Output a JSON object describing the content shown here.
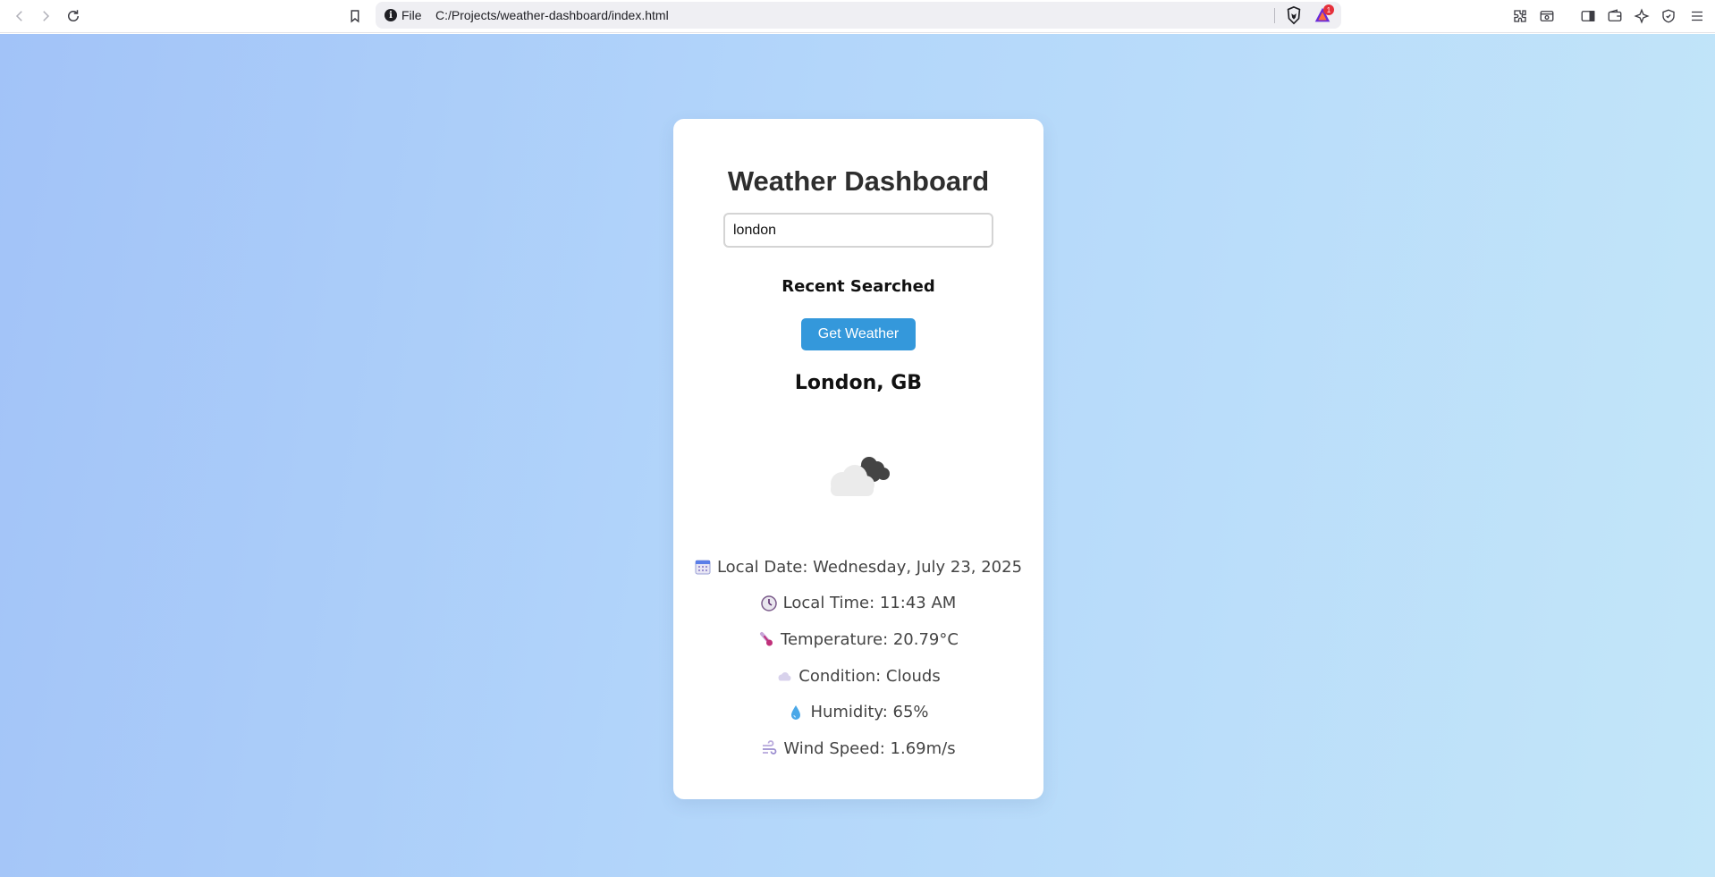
{
  "browser": {
    "url_scheme": "File",
    "url": "C:/Projects/weather-dashboard/index.html",
    "info_icon": "i",
    "rewards_badge": "1",
    "icons": [
      "back-icon",
      "forward-icon",
      "reload-icon",
      "bookmark-icon",
      "info-icon",
      "brave-shields-icon",
      "brave-rewards-icon",
      "extensions-icon",
      "tab-search-icon",
      "sidebar-icon",
      "wallet-icon",
      "leo-ai-icon",
      "vpn-icon",
      "menu-icon"
    ]
  },
  "app": {
    "title": "Weather Dashboard",
    "search": {
      "value": "london",
      "placeholder": ""
    },
    "recent_label": "Recent Searched",
    "button_label": "Get Weather",
    "location": "London, GB",
    "weather_icon": "cloud-icon",
    "details": [
      {
        "icon": "calendar-icon",
        "text": "Local Date: Wednesday, July 23, 2025"
      },
      {
        "icon": "clock-icon",
        "text": "Local Time: 11:43 AM"
      },
      {
        "icon": "thermometer-icon",
        "text": "Temperature: 20.79°C"
      },
      {
        "icon": "cloud-icon",
        "text": "Condition: Clouds"
      },
      {
        "icon": "droplet-icon",
        "text": "Humidity: 65%"
      },
      {
        "icon": "wind-icon",
        "text": "Wind Speed: 1.69m/s"
      }
    ]
  },
  "colors": {
    "accent": "#3498db",
    "background_start": "#a2c3f8",
    "background_end": "#c3e6f9",
    "card": "#ffffff"
  }
}
